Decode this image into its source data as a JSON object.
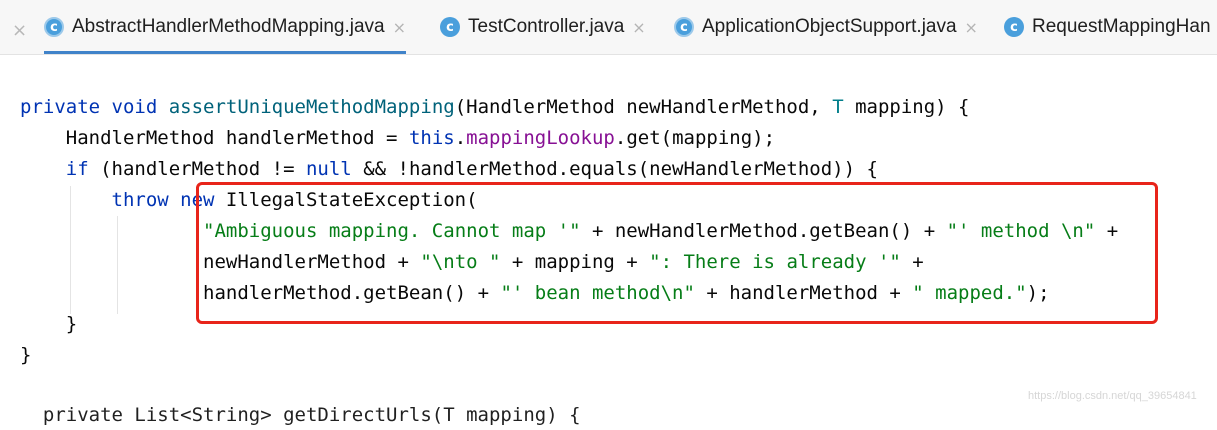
{
  "tabs": [
    {
      "title": "AbstractHandlerMethodMapping.java",
      "close": "×",
      "icon": "class-icon",
      "active": true
    },
    {
      "title": "TestController.java",
      "close": "×",
      "icon": "class-icon",
      "active": false
    },
    {
      "title": "ApplicationObjectSupport.java",
      "close": "×",
      "icon": "class-icon",
      "active": false
    },
    {
      "title": "RequestMappingHan",
      "close": "",
      "icon": "class-icon",
      "active": false
    }
  ],
  "tabbar": {
    "leading_close": "×",
    "icon_letter": "c"
  },
  "code": {
    "l1": {
      "kw": "private void ",
      "fn": "assertUniqueMethodMapping",
      "a": "(HandlerMethod newHandlerMethod, ",
      "tp": "T",
      "b": " mapping) {"
    },
    "l2": {
      "a": "    HandlerMethod handlerMethod = ",
      "kw": "this",
      "b": ".",
      "fld": "mappingLookup",
      "c": ".get(mapping);"
    },
    "l3": {
      "kw1": "    if ",
      "a": "(handlerMethod != ",
      "kw2": "null",
      "b": " && !handlerMethod.equals(newHandlerMethod)) {"
    },
    "l4": {
      "kw": "        throw new ",
      "a": "IllegalStateException("
    },
    "l5": {
      "indent": "                ",
      "s1": "\"Ambiguous mapping. Cannot map '\"",
      "a": " + newHandlerMethod.getBean() + ",
      "s2": "\"' method \\n\"",
      "b": " +"
    },
    "l6": {
      "indent": "                ",
      "a": "newHandlerMethod + ",
      "s1": "\"\\nto \"",
      "b": " + mapping + ",
      "s2": "\": There is already '\"",
      "c": " +"
    },
    "l7": {
      "indent": "                ",
      "a": "handlerMethod.getBean() + ",
      "s1": "\"' bean method\\n\"",
      "b": " + handlerMethod + ",
      "s2": "\" mapped.\"",
      "c": ");"
    },
    "l8": "    }",
    "l9": "}",
    "l10": "  private List<String> getDirectUrls(T mapping) {"
  },
  "watermark": "https://blog.csdn.net/qq_39654841",
  "colors": {
    "highlight_box": "#e8241a",
    "keyword": "#0033b3",
    "string": "#067d17",
    "method": "#00627a",
    "field": "#871094"
  }
}
